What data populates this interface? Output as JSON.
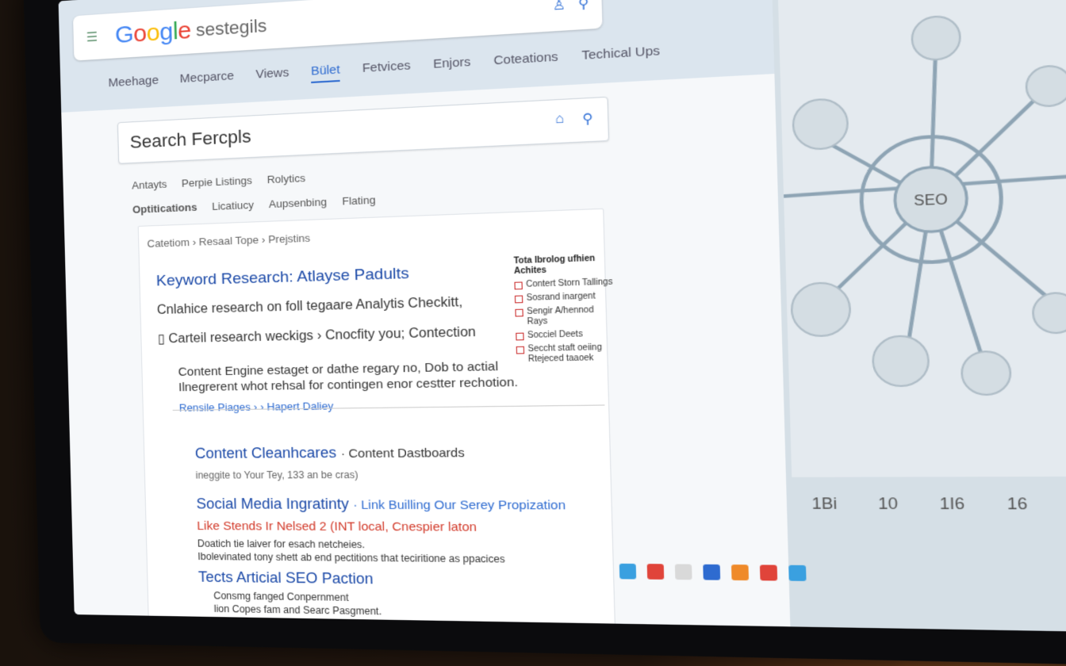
{
  "browser": {
    "logo": "Google",
    "address_text": "sestegils",
    "tabs": [
      "Meehage",
      "Mecparce",
      "Views",
      "Bület",
      "Fetvices",
      "Enjors",
      "Coteations",
      "Techical Ups"
    ],
    "active_tab_index": 3
  },
  "search": {
    "value": "Search Fercpls"
  },
  "filters": {
    "row1": [
      "Antayts",
      "Perpie Listings",
      "Rolytics"
    ],
    "row2": [
      "Optitications",
      "Licatiucy",
      "Aupsenbing",
      "Flating"
    ]
  },
  "card": {
    "breadcrumb": "Catetiom › Resaal Tope › Prejstins",
    "result1": {
      "title": "Keyword Research: Atlayse Padults",
      "line1": "Cnlahice research on foll tegaare Analytis Checkitt,",
      "line2": "Carteil research weckigs › Cnocfity you; Contection",
      "snippet": "Content Engine estaget or dathe regary no, Dob to actial Ilnegrerent whot rehsal for contingen enor cestter rechotion.",
      "links": "Rensile Piages › › Hapert Daliey"
    },
    "checklist": {
      "heading": "Tota Ibrolog ufhien Achites",
      "items": [
        "Contert Storn Tallings",
        "Sosrand inargent",
        "Sengir A/hennod Rays",
        "Socciel Deets",
        "Seccht staft oeiing Rtejeced taaoek"
      ]
    },
    "result2": {
      "title": "Content Cleanhcares",
      "title_suffix": "· Content Dastboards",
      "sub": "ineggite to Your Tey, 133 an be cras)"
    },
    "result3": {
      "title": "Social Media Ingratinty",
      "title_suffix": "· Link Builling Our Serey Propization",
      "red_line": "Like Stends Ir Nelsed 2 (INT local, Cnespier laton",
      "snippet1": "Doatich tie laiver for esach netcheies.",
      "snippet2": "Ibolevinated tony shett ab end pectitions that teciritione as ppacices",
      "title2": "Tects Articial SEO Paction",
      "snippet3": "Consmg fanged Conpernment",
      "snippet4": "lion Copes fam and Searc Pasgment."
    }
  },
  "side": {
    "hub_label": "SEO",
    "stats": [
      "1Bi",
      "10",
      "1I6",
      "16"
    ]
  },
  "colors": {
    "link_blue": "#1c4aa8",
    "accent_blue": "#2e6bd0",
    "warning_red": "#d23a2a"
  }
}
